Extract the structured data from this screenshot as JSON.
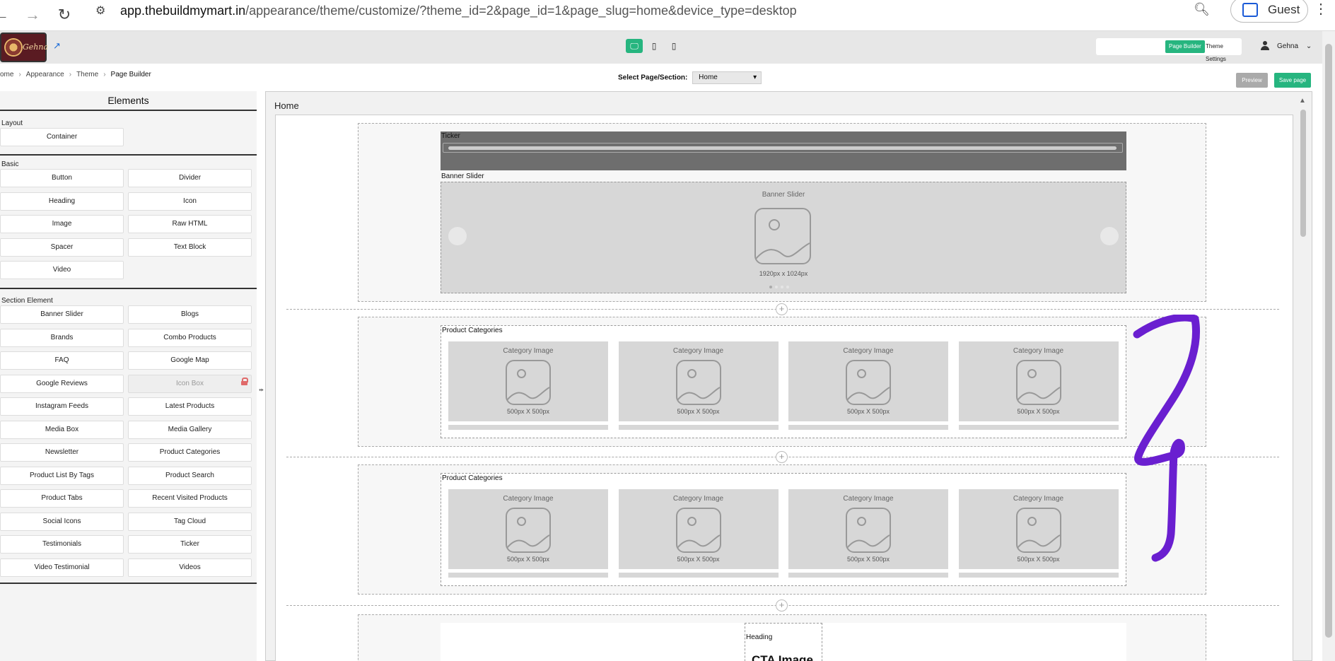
{
  "browser": {
    "url_host": "app.thebuildmymart.in",
    "url_path": "/appearance/theme/customize/?theme_id=2&page_id=1&page_slug=home&device_type=desktop",
    "profile_label": "Guest"
  },
  "header": {
    "logo_text": "Gehna",
    "devices": [
      "desktop-icon",
      "tablet-icon",
      "mobile-icon"
    ],
    "page_builder_label": "Page Builder",
    "theme_settings_label": "Theme Settings",
    "user_name": "Gehna"
  },
  "breadcrumb": {
    "items": [
      "ome",
      "Appearance",
      "Theme",
      "Page Builder"
    ]
  },
  "page_select": {
    "label": "Select Page/Section:",
    "value": "Home"
  },
  "actions": {
    "preview_label": "Preview",
    "save_label": "Save page"
  },
  "elements_panel": {
    "title": "Elements",
    "groups": [
      {
        "title": "Layout",
        "items": [
          "Container"
        ]
      },
      {
        "title": "Basic",
        "items": [
          "Button",
          "Divider",
          "Heading",
          "Icon",
          "Image",
          "Raw HTML",
          "Spacer",
          "Text Block",
          "Video"
        ]
      },
      {
        "title": "Section Element",
        "items": [
          "Banner Slider",
          "Blogs",
          "Brands",
          "Combo Products",
          "FAQ",
          "Google Map",
          "Google Reviews",
          "Icon Box",
          "Instagram Feeds",
          "Latest Products",
          "Media Box",
          "Media Gallery",
          "Newsletter",
          "Product Categories",
          "Product List By Tags",
          "Product Search",
          "Product Tabs",
          "Recent Visited Products",
          "Social Icons",
          "Tag Cloud",
          "Testimonials",
          "Ticker",
          "Video Testimonial",
          "Videos"
        ]
      }
    ]
  },
  "canvas": {
    "page_title": "Home",
    "ticker_label": "Ticker",
    "banner": {
      "label": "Banner Slider",
      "inner_title": "Banner Slider",
      "size": "1920px x 1024px"
    },
    "category_sections": [
      {
        "label": "Product Categories",
        "cards": [
          {
            "title": "Category Image",
            "size": "500px X 500px"
          },
          {
            "title": "Category Image",
            "size": "500px X 500px"
          },
          {
            "title": "Category Image",
            "size": "500px X 500px"
          },
          {
            "title": "Category Image",
            "size": "500px X 500px"
          }
        ]
      },
      {
        "label": "Product Categories",
        "cards": [
          {
            "title": "Category Image",
            "size": "500px X 500px"
          },
          {
            "title": "Category Image",
            "size": "500px X 500px"
          },
          {
            "title": "Category Image",
            "size": "500px X 500px"
          },
          {
            "title": "Category Image",
            "size": "500px X 500px"
          }
        ]
      }
    ],
    "cta": {
      "heading_label": "Heading",
      "heading_text": "CTA Image"
    }
  },
  "colors": {
    "accent": "#26b57f",
    "annotation": "#6a1fd0"
  }
}
